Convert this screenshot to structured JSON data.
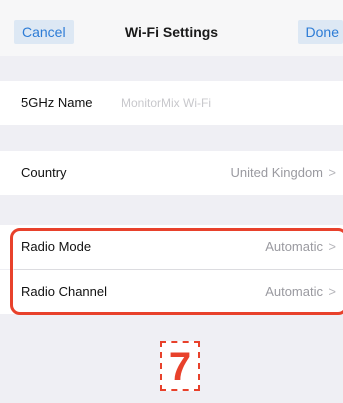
{
  "navbar": {
    "cancel_label": "Cancel",
    "title": "Wi-Fi Settings",
    "done_label": "Done"
  },
  "rows": {
    "name": {
      "label": "5GHz Name",
      "placeholder": "MonitorMix Wi-Fi"
    },
    "country": {
      "label": "Country",
      "value": "United Kingdom"
    },
    "radio_mode": {
      "label": "Radio Mode",
      "value": "Automatic"
    },
    "radio_channel": {
      "label": "Radio Channel",
      "value": "Automatic"
    }
  },
  "chevron_icon": ">",
  "annotation": {
    "step": "7"
  },
  "colors": {
    "accent": "#2d7cd6",
    "highlight": "#e8412b",
    "background": "#efeff4"
  }
}
